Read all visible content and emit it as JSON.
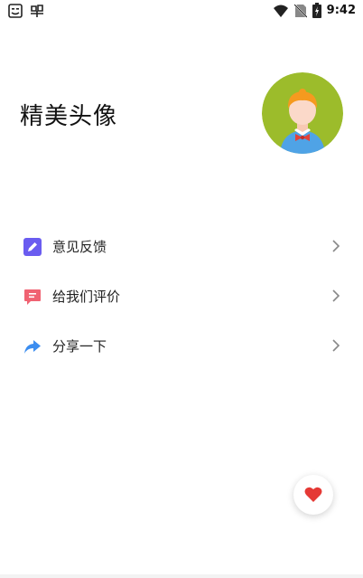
{
  "status_bar": {
    "time": "9:42",
    "left_icons": [
      "face-icon",
      "bug-icon"
    ],
    "right_icons": [
      "wifi-icon",
      "no-sim-icon",
      "battery-charging-icon"
    ]
  },
  "header": {
    "title": "精美头像",
    "avatar_icon": "boy-avatar-icon"
  },
  "menu": {
    "items": [
      {
        "label": "意见反馈",
        "icon": "edit-icon",
        "icon_color": "#6a5cf0"
      },
      {
        "label": "给我们评价",
        "icon": "comment-icon",
        "icon_color": "#f06272"
      },
      {
        "label": "分享一下",
        "icon": "share-icon",
        "icon_color": "#3b8df0"
      }
    ]
  },
  "fab": {
    "icon": "heart-icon",
    "color": "#e53935"
  },
  "colors": {
    "avatar_bg": "#9cbc2b",
    "background": "#ffffff"
  }
}
